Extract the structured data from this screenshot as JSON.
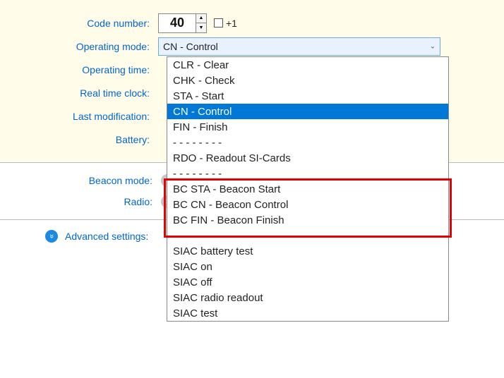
{
  "labels": {
    "code_number": "Code number:",
    "operating_mode": "Operating mode:",
    "operating_time": "Operating time:",
    "real_time_clock": "Real time clock:",
    "last_modification": "Last modification:",
    "battery": "Battery:",
    "beacon_mode": "Beacon mode:",
    "radio": "Radio:",
    "advanced_settings": "Advanced settings:"
  },
  "code_number_value": "40",
  "plus_one_label": "+1",
  "operating_mode_selected": "CN - Control",
  "dropdown_options": [
    {
      "label": "CLR - Clear"
    },
    {
      "label": "CHK - Check"
    },
    {
      "label": "STA - Start"
    },
    {
      "label": "CN - Control"
    },
    {
      "label": "FIN - Finish"
    },
    {
      "label": "-  -  -  -  -  -  -  -"
    },
    {
      "label": "RDO - Readout SI-Cards"
    },
    {
      "label": "-  -  -  -  -  -  -  -"
    },
    {
      "label": "BC STA - Beacon Start"
    },
    {
      "label": "BC CN - Beacon Control"
    },
    {
      "label": "BC FIN - Beacon Finish"
    },
    {
      "label": "-  -  -  -  -  -  -  -"
    },
    {
      "label": "SIAC battery test"
    },
    {
      "label": "SIAC on"
    },
    {
      "label": "SIAC off"
    },
    {
      "label": "SIAC radio readout"
    },
    {
      "label": "SIAC test"
    }
  ],
  "selected_index": 3,
  "highlight_box": {
    "first_index": 8,
    "last_index": 10
  }
}
